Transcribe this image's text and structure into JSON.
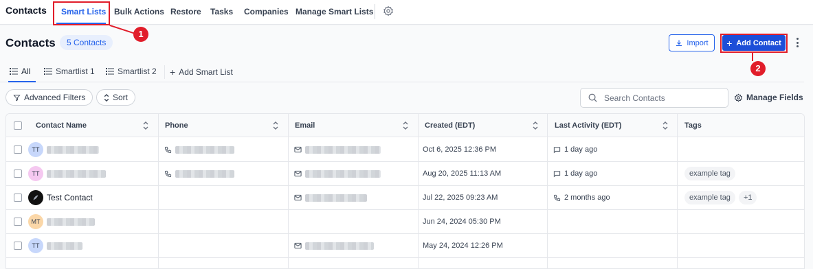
{
  "topnav": {
    "brand": "Contacts",
    "items": [
      {
        "label": "Smart Lists"
      },
      {
        "label": "Bulk Actions"
      },
      {
        "label": "Restore"
      },
      {
        "label": "Tasks"
      },
      {
        "label": "Companies"
      },
      {
        "label": "Manage Smart Lists"
      }
    ],
    "settings_icon": "gear-icon"
  },
  "annotations": {
    "first": "1",
    "second": "2",
    "color": "#e11d2a"
  },
  "header": {
    "title": "Contacts",
    "count": "5 Contacts",
    "import_label": "Import",
    "add_label": "Add Contact",
    "accent": "#2563eb"
  },
  "subtabs": {
    "items": [
      {
        "label": "All"
      },
      {
        "label": "Smartlist 1"
      },
      {
        "label": "Smartlist 2"
      }
    ],
    "add_label": "Add Smart List"
  },
  "toolbar": {
    "advanced_filters": "Advanced Filters",
    "sort": "Sort",
    "search_placeholder": "Search Contacts",
    "manage_fields": "Manage Fields"
  },
  "table": {
    "columns": [
      "Contact Name",
      "Phone",
      "Email",
      "Created (EDT)",
      "Last Activity (EDT)",
      "Tags"
    ],
    "rows": [
      {
        "initials": "TT",
        "avatar_color": "#c7d7fb",
        "name": "",
        "created": "Oct 6, 2025 12:36 PM",
        "activity": "1 day ago",
        "activity_icon": "chat-icon",
        "tags": [],
        "extra": ""
      },
      {
        "initials": "TT",
        "avatar_color": "#f5c8f0",
        "name": "",
        "created": "Aug 20, 2025 11:13 AM",
        "activity": "1 day ago",
        "activity_icon": "chat-icon",
        "tags": [
          "example tag"
        ],
        "extra": ""
      },
      {
        "initials": "",
        "avatar_color": "#111111",
        "name": "Test Contact",
        "created": "Jul 22, 2025 09:23 AM",
        "activity": "2 months ago",
        "activity_icon": "phone-icon",
        "tags": [
          "example tag"
        ],
        "extra": "+1"
      },
      {
        "initials": "MT",
        "avatar_color": "#fbd7a8",
        "name": "",
        "created": "Jun 24, 2024 05:30 PM",
        "activity": "",
        "activity_icon": "",
        "tags": [],
        "extra": ""
      },
      {
        "initials": "TT",
        "avatar_color": "#c7d7fb",
        "name": "",
        "created": "May 24, 2024 12:26 PM",
        "activity": "",
        "activity_icon": "",
        "tags": [],
        "extra": ""
      }
    ]
  }
}
